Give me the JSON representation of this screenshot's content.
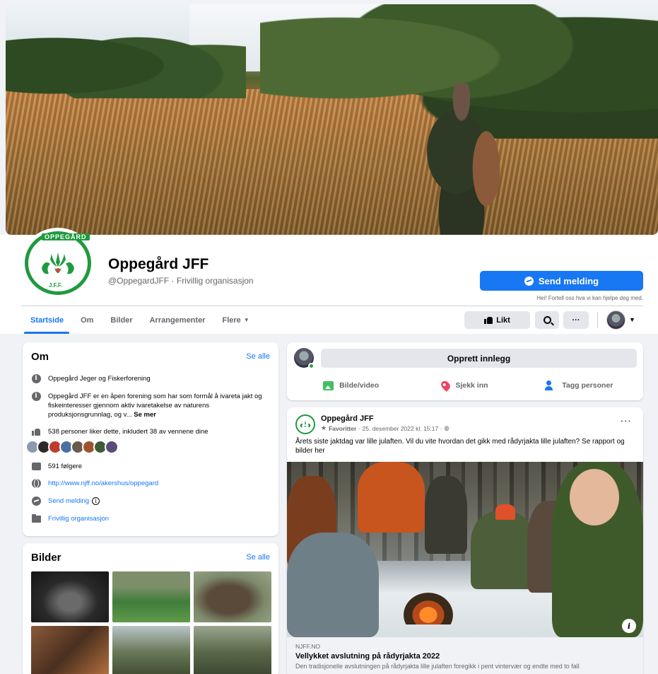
{
  "page": {
    "name": "Oppegård JFF",
    "handle_category": "@OppegardJFF · Frivillig organisasjon",
    "logo_top_text": "OPPEGÅRD",
    "logo_bottom_text": "J.F.F."
  },
  "header": {
    "send_button_label": "Send melding",
    "help_text": "Hei! Fortell oss hva vi kan hjelpe deg med.",
    "liked_label": "Likt",
    "more_glyph": "···"
  },
  "tabs": [
    {
      "label": "Startside",
      "active": true
    },
    {
      "label": "Om"
    },
    {
      "label": "Bilder"
    },
    {
      "label": "Arrangementer"
    },
    {
      "label": "Flere"
    }
  ],
  "om": {
    "title": "Om",
    "see_all": "Se alle",
    "full_name": "Oppegård Jeger og Fiskerforening",
    "description": "Oppegård JFF er en åpen forening som har som formål å ivareta jakt og fiskeinteresser gjennom aktiv ivaretakelse av naturens produksjonsgrunnlag, og v...",
    "see_more": "Se mer",
    "likes": "538 personer liker dette, inkludert 38 av vennene dine",
    "followers": "591 følgere",
    "website": "http://www.njff.no/akershus/oppegard",
    "send_message": "Send melding",
    "category": "Frivillig organisasjon"
  },
  "bilder": {
    "title": "Bilder",
    "see_all": "Se alle"
  },
  "create_post": {
    "button_label": "Opprett innlegg",
    "actions": [
      "Bilde/video",
      "Sjekk inn",
      "Tagg personer"
    ]
  },
  "post": {
    "author": "Oppegård JFF",
    "favorite": "Favoritter",
    "date": "· 25. desember 2022 kl. 15:17 ·",
    "more": "···",
    "text": "Årets siste jaktdag var lille julaften.  Vil du vite hvordan det gikk med rådyrjakta lille julaften? Se rapport og bilder her",
    "link_domain": "NJFF.NO",
    "link_title": "Vellykket avslutning på rådyrjakta 2022",
    "link_description": "Den tradisjonelle avslutningen på rådyrjakta lille julaften foregikk i pent vintervær og endte med to fall"
  },
  "colors": {
    "brand_blue": "#1877f2",
    "logo_green": "#1f9a3f",
    "background": "#f0f2f5"
  },
  "icons": {
    "send": "messenger-icon",
    "like": "thumbs-up-icon",
    "search": "search-icon",
    "more": "more-horizontal-icon",
    "info": "info-icon",
    "globe": "globe-icon",
    "followers": "follower-icon",
    "folder": "category-icon",
    "photo": "photo-video-icon",
    "checkin": "location-pin-icon",
    "tag": "tag-people-icon"
  }
}
